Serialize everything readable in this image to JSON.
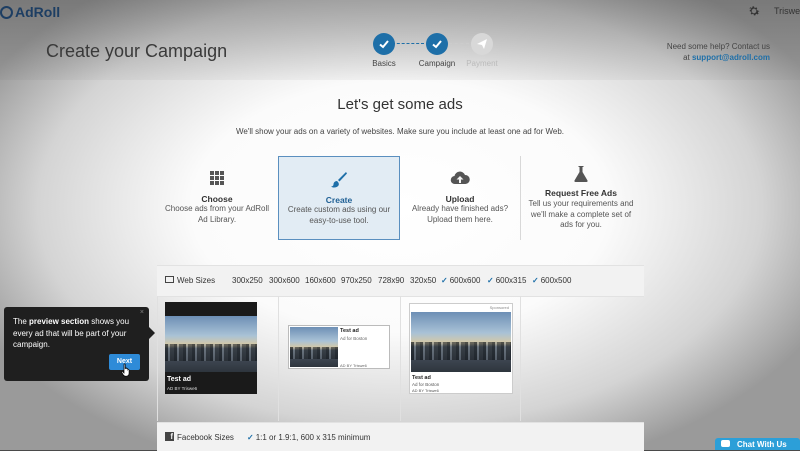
{
  "app": {
    "brand": "AdRoll",
    "user": "Triswe"
  },
  "header": {
    "title": "Create your Campaign",
    "steps": [
      {
        "label": "Basics",
        "state": "done"
      },
      {
        "label": "Campaign",
        "state": "done"
      },
      {
        "label": "Payment",
        "state": "todo"
      }
    ],
    "help_text": "Need some help? Contact us",
    "help_at": "at",
    "help_email": "support@adroll.com"
  },
  "section": {
    "title": "Let's get some ads",
    "subtitle": "We'll show your ads on a variety of websites. Make sure you include at least one ad for Web."
  },
  "options": [
    {
      "title": "Choose",
      "desc": "Choose ads from your AdRoll Ad Library.",
      "icon": "grid-icon"
    },
    {
      "title": "Create",
      "desc": "Create custom ads using our easy-to-use tool.",
      "icon": "brush-icon",
      "selected": true
    },
    {
      "title": "Upload",
      "desc": "Already have finished ads? Upload them here.",
      "icon": "cloud-upload-icon"
    },
    {
      "title": "Request Free Ads",
      "desc": "Tell us your requirements and we'll make a complete set of ads for you.",
      "icon": "flask-icon"
    }
  ],
  "web_sizes": {
    "label": "Web Sizes",
    "sizes": [
      {
        "size": "300x250",
        "checked": false
      },
      {
        "size": "300x600",
        "checked": false
      },
      {
        "size": "160x600",
        "checked": false
      },
      {
        "size": "970x250",
        "checked": false
      },
      {
        "size": "728x90",
        "checked": false
      },
      {
        "size": "320x50",
        "checked": false
      },
      {
        "size": "600x600",
        "checked": true
      },
      {
        "size": "600x315",
        "checked": true
      },
      {
        "size": "600x500",
        "checked": true
      }
    ]
  },
  "previews": {
    "ad_title": "Test ad",
    "ad_sub": "Ad for Boston",
    "ad_by": "AD BY Triswe6",
    "sponsored": "Sponsored"
  },
  "facebook": {
    "label": "Facebook Sizes",
    "requirement": "1:1 or 1.9:1, 600 x 315 minimum"
  },
  "tooltip": {
    "pre": "The ",
    "bold": "preview section",
    "post": " shows you every ad that will be part of your campaign.",
    "next_label": "Next",
    "close": "×"
  },
  "chat": {
    "label": "Chat With Us"
  },
  "colors": {
    "accent": "#1e6fa8",
    "brand_navy": "#1d3e63",
    "chat": "#2c9fd8",
    "next_button": "#2e8bd8"
  }
}
